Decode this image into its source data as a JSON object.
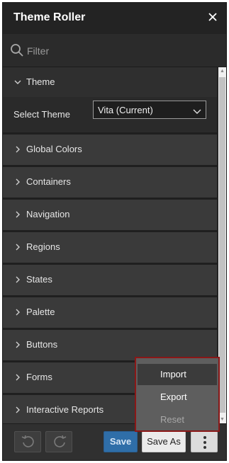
{
  "dialog": {
    "title": "Theme Roller",
    "close_icon": "close-icon"
  },
  "filter": {
    "placeholder": "Filter",
    "value": "",
    "icon": "search-icon"
  },
  "theme_section": {
    "label": "Theme",
    "expanded": true,
    "select_label": "Select Theme",
    "selected_value": "Vita (Current)"
  },
  "sections": [
    {
      "label": "Global Colors"
    },
    {
      "label": "Containers"
    },
    {
      "label": "Navigation"
    },
    {
      "label": "Regions"
    },
    {
      "label": "States"
    },
    {
      "label": "Palette"
    },
    {
      "label": "Buttons"
    },
    {
      "label": "Forms"
    },
    {
      "label": "Interactive Reports"
    }
  ],
  "footer": {
    "undo_icon": "undo-icon",
    "redo_icon": "redo-icon",
    "save_label": "Save",
    "save_as_label": "Save As",
    "more_icon": "more-vertical-icon"
  },
  "menu": {
    "items": [
      {
        "label": "Import",
        "state": "highlighted"
      },
      {
        "label": "Export",
        "state": "normal"
      },
      {
        "label": "Reset",
        "state": "disabled"
      }
    ]
  },
  "colors": {
    "panel_bg": "#232323",
    "section_bg": "#3a3a3a",
    "save_blue": "#2f6ea8",
    "menu_outline": "#8a1717"
  }
}
